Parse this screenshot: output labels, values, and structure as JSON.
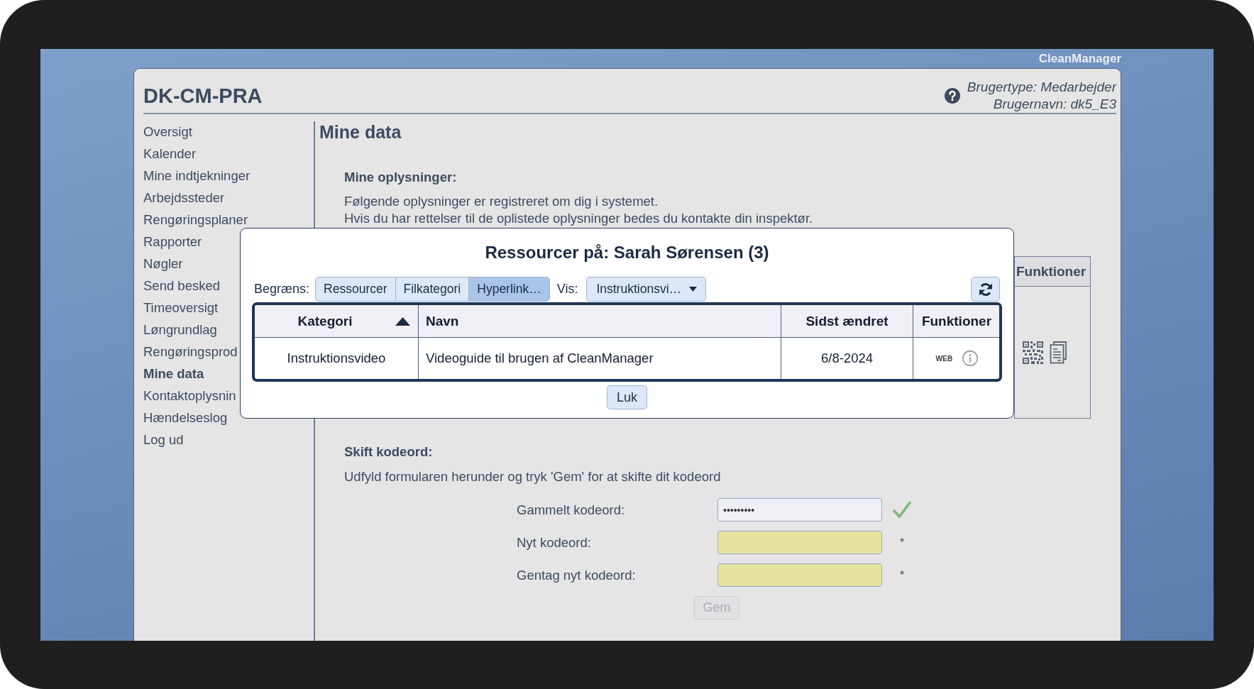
{
  "app_label": "CleanManager",
  "header": {
    "title": "DK-CM-PRA",
    "user_type": "Brugertype: Medarbejder",
    "user_name": "Brugernavn: dk5_E3"
  },
  "sidebar": {
    "items": [
      {
        "label": "Oversigt",
        "selected": false
      },
      {
        "label": "Kalender",
        "selected": false
      },
      {
        "label": "Mine indtjekninger",
        "selected": false
      },
      {
        "label": "Arbejdssteder",
        "selected": false
      },
      {
        "label": "Rengøringsplaner",
        "selected": false
      },
      {
        "label": "Rapporter",
        "selected": false
      },
      {
        "label": "Nøgler",
        "selected": false
      },
      {
        "label": "Send besked",
        "selected": false
      },
      {
        "label": "Timeoversigt",
        "selected": false
      },
      {
        "label": "Løngrundlag",
        "selected": false
      },
      {
        "label": "Rengøringsprod",
        "selected": false
      },
      {
        "label": "Mine data",
        "selected": true
      },
      {
        "label": "Kontaktoplysnin",
        "selected": false
      },
      {
        "label": "Hændelseslog",
        "selected": false
      },
      {
        "label": "Log ud",
        "selected": false
      }
    ]
  },
  "page": {
    "title": "Mine data",
    "info_section": {
      "heading": "Mine oplysninger:",
      "lines": [
        "Følgende oplysninger er registreret om dig i systemet.",
        "Hvis du har rettelser til de oplistede oplysninger bedes du kontakte din inspektør."
      ]
    },
    "resource_table": {
      "columns": [
        "Funktioner"
      ]
    },
    "password_section": {
      "heading": "Skift kodeord:",
      "text": "Udfyld formularen herunder og tryk 'Gem' for at skifte dit kodeord",
      "fields": [
        {
          "label": "Gammelt kodeord:",
          "value": "•••••••••",
          "highlighted": false,
          "valid": true
        },
        {
          "label": "Nyt kodeord:",
          "highlighted": true,
          "valid": false,
          "marker": "*"
        },
        {
          "label": "Gentag nyt kodeord:",
          "highlighted": true,
          "valid": false,
          "marker": "*"
        }
      ],
      "save_button": {
        "label": "Gem",
        "disabled": true
      }
    }
  },
  "dialog": {
    "title": "Ressourcer på: Sarah Sørensen (3)",
    "filter_label": "Begræns:",
    "filters": [
      {
        "label": "Ressourcer",
        "selected": false
      },
      {
        "label": "Filkategori",
        "selected": false
      },
      {
        "label": "Hyperlink…",
        "selected": true
      }
    ],
    "view_label": "Vis:",
    "view_dropdown": {
      "value": "Instruktionsvi…"
    },
    "table": {
      "columns": [
        {
          "label": "Kategori",
          "sorted_ascending": true
        },
        {
          "label": "Navn",
          "sorted_ascending": false
        },
        {
          "label": "Sidst ændret",
          "sorted_ascending": false
        },
        {
          "label": "Funktioner",
          "sorted_ascending": false
        }
      ],
      "rows": [
        {
          "cells": [
            "Instruktionsvideo",
            "Videoguide til brugen af CleanManager",
            "6/8-2024"
          ],
          "web_label": "WEB"
        }
      ]
    },
    "close_button": "Luk"
  }
}
